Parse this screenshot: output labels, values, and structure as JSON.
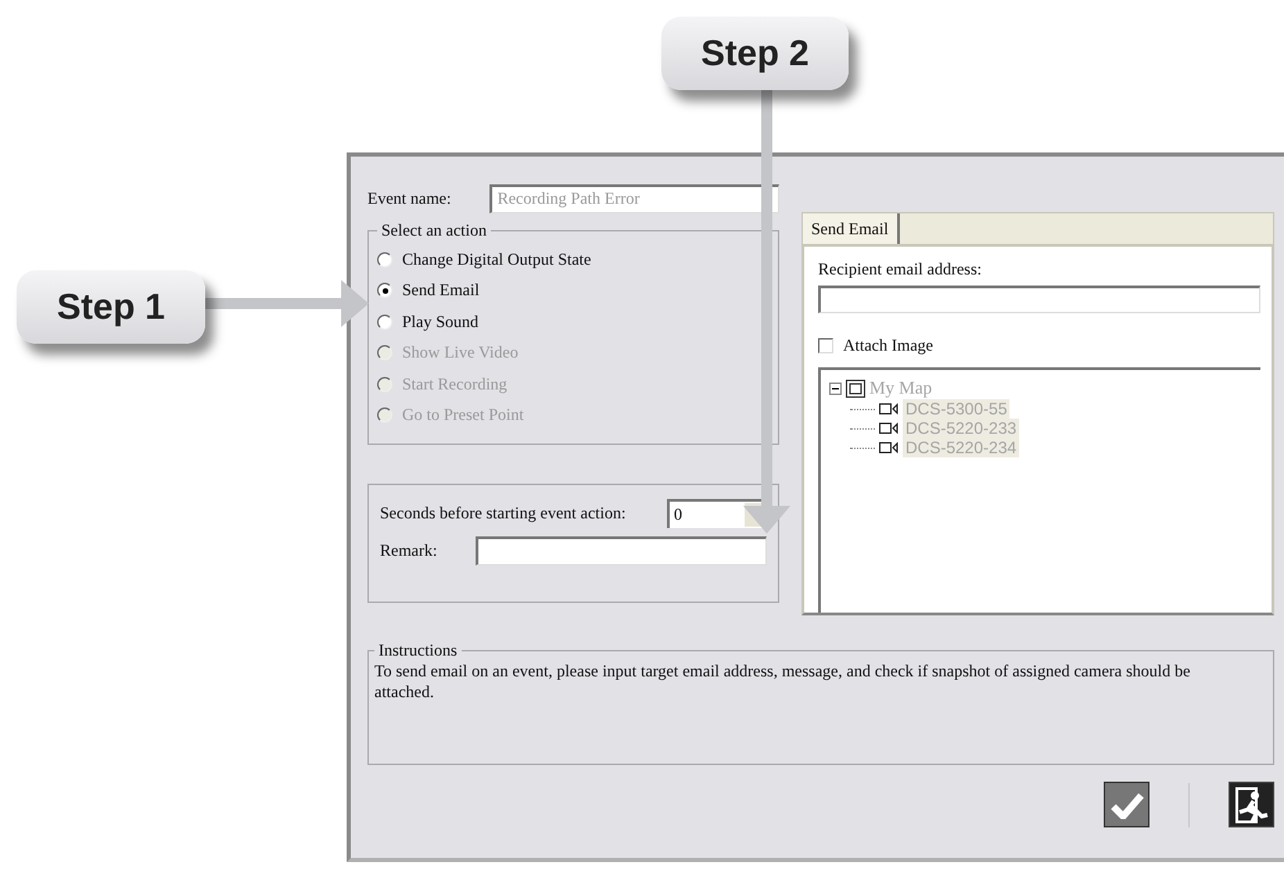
{
  "callouts": [
    {
      "label": "Step 1"
    },
    {
      "label": "Step 2"
    }
  ],
  "event_name": {
    "label": "Event name:",
    "value": "Recording Path Error",
    "disabled": true
  },
  "action_group": {
    "title": "Select an action",
    "options": [
      {
        "label": "Change Digital Output State",
        "selected": false,
        "disabled": false
      },
      {
        "label": "Send Email",
        "selected": true,
        "disabled": false
      },
      {
        "label": "Play Sound",
        "selected": false,
        "disabled": false
      },
      {
        "label": "Show Live Video",
        "selected": false,
        "disabled": true
      },
      {
        "label": "Start Recording",
        "selected": false,
        "disabled": true
      },
      {
        "label": "Go to Preset Point",
        "selected": false,
        "disabled": true
      }
    ]
  },
  "delay": {
    "label": "Seconds before starting event action:",
    "value": "0"
  },
  "remark": {
    "label": "Remark:"
  },
  "tabs": [
    {
      "label": "Send Email",
      "selected": true
    }
  ],
  "recipient": {
    "label": "Recipient email address:"
  },
  "attach_image": {
    "label": "Attach Image",
    "checked": false
  },
  "tree": {
    "label": "My Map",
    "expanded": true,
    "disabled": true,
    "children": [
      {
        "label": "DCS-5300-55"
      },
      {
        "label": "DCS-5220-233"
      },
      {
        "label": "DCS-5220-234"
      }
    ]
  },
  "instructions": {
    "title": "Instructions",
    "text": "To send email on an event, please input target email address, message, and check if snapshot of assigned camera should be attached."
  }
}
